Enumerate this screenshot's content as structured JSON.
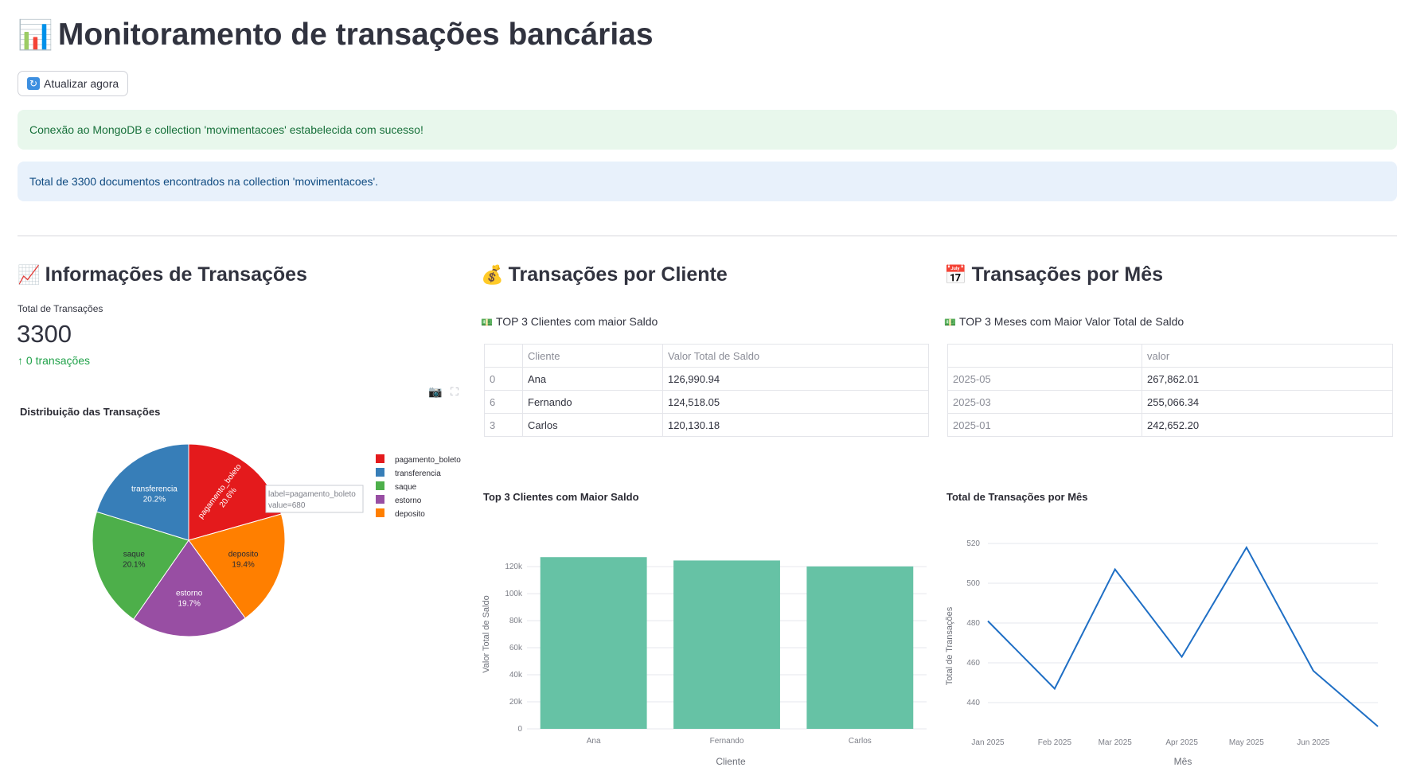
{
  "page": {
    "title_emoji": "📊",
    "title": "Monitoramento de transações bancárias",
    "refresh_button": {
      "icon": "🔄",
      "label": "Atualizar agora"
    },
    "success_alert": "Conexão ao MongoDB e collection 'movimentacoes' estabelecida com sucesso!",
    "info_alert": "Total de 3300 documentos encontrados na collection 'movimentacoes'."
  },
  "col1": {
    "emoji": "📈",
    "heading": "Informações de Transações",
    "metric": {
      "label": "Total de Transações",
      "value": "3300",
      "delta_icon": "↑",
      "delta": "0 transações"
    }
  },
  "col2": {
    "emoji": "💰",
    "heading": "Transações por Cliente",
    "sub_emoji": "💵",
    "subheading": "TOP 3 Clientes com maior Saldo",
    "table": {
      "headers": [
        "",
        "Cliente",
        "Valor Total de Saldo"
      ],
      "rows": [
        [
          "0",
          "Ana",
          "126,990.94"
        ],
        [
          "6",
          "Fernando",
          "124,518.05"
        ],
        [
          "3",
          "Carlos",
          "120,130.18"
        ]
      ]
    }
  },
  "col3": {
    "emoji": "📅",
    "heading": "Transações por Mês",
    "sub_emoji": "💵",
    "subheading": "TOP 3 Meses com Maior Valor Total de Saldo",
    "table": {
      "headers": [
        "",
        "valor"
      ],
      "rows": [
        [
          "2025-05",
          "267,862.01"
        ],
        [
          "2025-03",
          "255,066.34"
        ],
        [
          "2025-01",
          "242,652.20"
        ]
      ]
    }
  },
  "chart_data": [
    {
      "type": "pie",
      "title": "Distribuição das Transações",
      "labels": [
        "pagamento_boleto",
        "transferencia",
        "saque",
        "estorno",
        "deposito"
      ],
      "values": [
        680,
        667,
        663,
        650,
        640
      ],
      "percents": [
        "20.6%",
        "20.2%",
        "20.1%",
        "19.7%",
        "19.4%"
      ],
      "slice_order": [
        "pagamento_boleto",
        "deposito",
        "estorno",
        "saque",
        "transferencia"
      ],
      "colors": {
        "pagamento_boleto": "#e41a1c",
        "transferencia": "#377eb8",
        "saque": "#4daf4a",
        "estorno": "#984ea3",
        "deposito": "#ff7f00"
      },
      "legend_position": "right",
      "tooltip": {
        "line1": "label=pagamento_boleto",
        "line2": "value=680"
      }
    },
    {
      "type": "bar",
      "title": "Top 3 Clientes com Maior Saldo",
      "categories": [
        "Ana",
        "Fernando",
        "Carlos"
      ],
      "values": [
        126990.94,
        124518.05,
        120130.18
      ],
      "xlabel": "Cliente",
      "ylabel": "Valor Total de Saldo",
      "ylim": [
        0,
        133000
      ],
      "yticks": [
        0,
        20000,
        40000,
        60000,
        80000,
        100000,
        120000
      ],
      "ytick_labels": [
        "0",
        "20k",
        "40k",
        "60k",
        "80k",
        "100k",
        "120k"
      ],
      "color": "#66c2a5",
      "grid": true
    },
    {
      "type": "line",
      "title": "Total de Transações por Mês",
      "x": [
        "2025-01-01",
        "2025-02-01",
        "2025-03-01",
        "2025-04-01",
        "2025-05-01",
        "2025-06-01",
        "2025-07-01"
      ],
      "y": [
        481,
        447,
        507,
        463,
        518,
        456,
        428
      ],
      "xtick_labels": [
        "Jan 2025",
        "Feb 2025",
        "Mar 2025",
        "Apr 2025",
        "May 2025",
        "Jun 2025"
      ],
      "xlabel": "Mês",
      "ylabel": "Total de Transações",
      "ylim": [
        430,
        520
      ],
      "yticks": [
        440,
        460,
        480,
        500,
        520
      ],
      "color": "#1f6fc5",
      "grid": true
    }
  ]
}
